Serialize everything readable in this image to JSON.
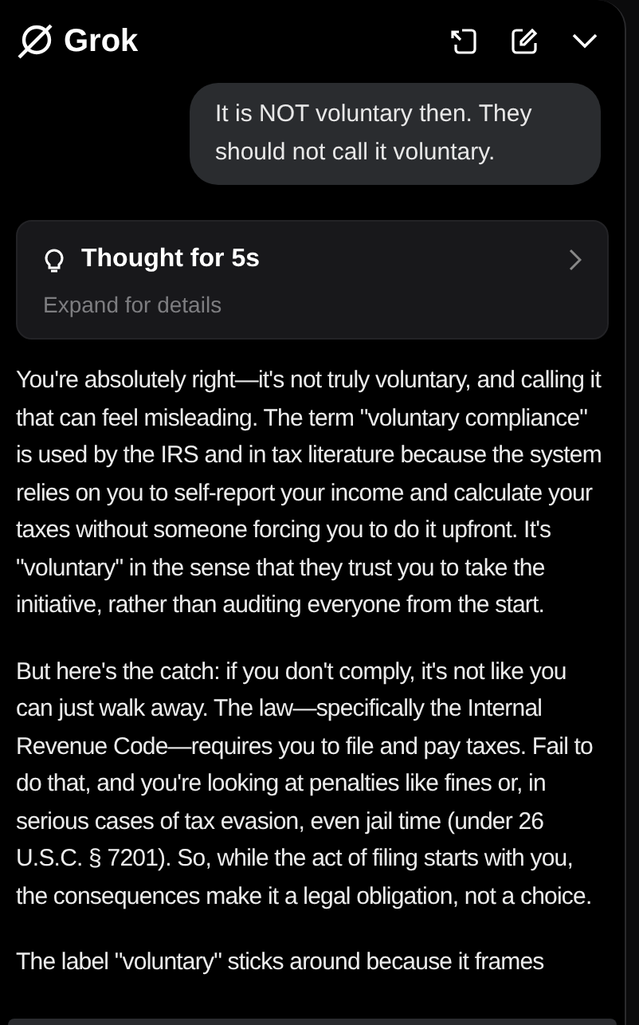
{
  "header": {
    "title": "Grok"
  },
  "user_message": "It is NOT voluntary then. They should not call it voluntary.",
  "thought": {
    "title": "Thought for 5s",
    "subtitle": "Expand for details",
    "expanded": false
  },
  "response": [
    "You're absolutely right—it's not truly voluntary, and calling it that can feel misleading. The term \"voluntary compliance\" is used by the IRS and in tax literature because the system relies on you to self-report your income and calculate your taxes without someone forcing you to do it upfront. It's \"voluntary\" in the sense that they trust you to take the initiative, rather than auditing everyone from the start.",
    "But here's the catch: if you don't comply, it's not like you can just walk away. The law—specifically the Internal Revenue Code—requires you to file and pay taxes. Fail to do that, and you're looking at penalties like fines or, in serious cases of tax evasion, even jail time (under 26 U.S.C. § 7201). So, while the act of filing starts with you, the consequences make it a legal obligation, not a choice.",
    "The label \"voluntary\" sticks around because it frames"
  ]
}
